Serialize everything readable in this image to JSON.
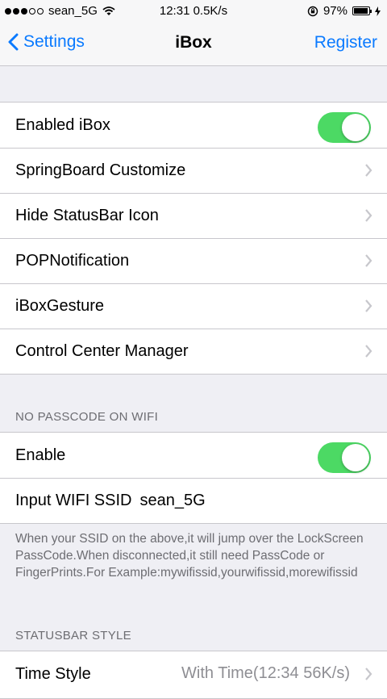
{
  "status_bar": {
    "carrier": "sean_5G",
    "time_speed": "12:31 0.5K/s",
    "battery": "97%",
    "battery_level": 0.97,
    "signal_icon": "signal-dots-icon",
    "wifi_icon": "wifi-icon",
    "lock_icon": "rotation-lock-icon",
    "charging_icon": "bolt-icon"
  },
  "nav": {
    "back_label": "Settings",
    "title": "iBox",
    "right_label": "Register"
  },
  "main_group": {
    "enabled_label": "Enabled iBox",
    "enabled_on": true,
    "items": [
      {
        "label": "SpringBoard Customize"
      },
      {
        "label": "Hide StatusBar Icon"
      },
      {
        "label": "POPNotification"
      },
      {
        "label": "iBoxGesture"
      },
      {
        "label": "Control Center Manager"
      }
    ]
  },
  "wifi_section": {
    "header": "NO PASSCODE ON WIFI",
    "enable_label": "Enable",
    "enable_on": true,
    "ssid_label": "Input WIFI SSID",
    "ssid_value": "sean_5G",
    "footer": "When your SSID on the above,it will jump over the LockScreen PassCode.When disconnected,it still need PassCode or FingerPrints.For Example:mywifissid,yourwifissid,morewifissid"
  },
  "statusbar_section": {
    "header": "STATUSBAR STYLE",
    "time_style_label": "Time Style",
    "time_style_value": "With Time(12:34 56K/s)"
  },
  "colors": {
    "accent": "#0a7aff",
    "toggle_on": "#4cd964",
    "background": "#efeff4"
  }
}
